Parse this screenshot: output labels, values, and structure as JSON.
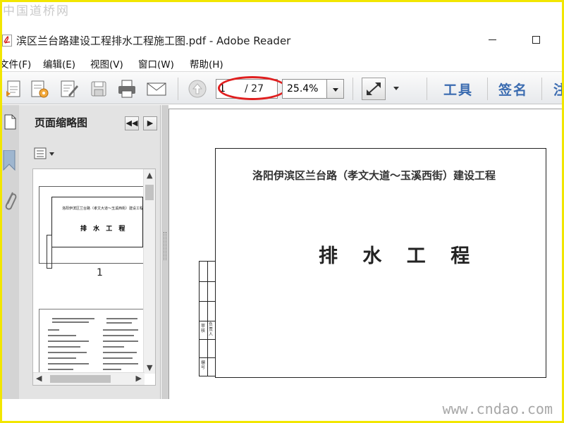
{
  "watermark": {
    "top": "中国道桥网",
    "bottom": "www.cndao.com"
  },
  "window": {
    "title": "滨区兰台路建设工程排水工程施工图.pdf - Adobe Reader",
    "min_symbol": "",
    "max_symbol": ""
  },
  "menu": [
    "文件(F)",
    "编辑(E)",
    "视图(V)",
    "窗口(W)",
    "帮助(H)"
  ],
  "toolbar": {
    "page_current": "1",
    "page_total": "/ 27",
    "zoom": "25.4%",
    "tools_label": "工具",
    "sign_label": "签名",
    "comment_label": "注"
  },
  "nav_panel": {
    "title": "页面缩略图",
    "prev_symbol": "◀◀",
    "next_symbol": "▶",
    "thumbnail_1_label": "1",
    "thumbnail_1_subtitle": "洛阳伊滨区兰台路（孝文大道～玉溪西街）建设工程",
    "thumbnail_1_title": "排 水 工 程"
  },
  "document": {
    "subtitle": "洛阳伊滨区兰台路（孝文大道～玉溪西街）建设工程",
    "main_title": "排 水 工 程",
    "title_block_text": [
      "审核",
      "负责人",
      "编号"
    ]
  },
  "colors": {
    "frame": "#f2e600",
    "annotation": "#e01f1f",
    "tool_link": "#3a6bb0",
    "panel_bg": "#e3e3e3",
    "toolbar_bg": "#e7e9ec"
  },
  "icons": [
    "pdf-file-icon",
    "create-pdf-icon",
    "settings-pdf-icon",
    "edit-icon",
    "save-icon",
    "print-icon",
    "email-icon",
    "previous-page-icon",
    "fit-page-icon",
    "pages-icon",
    "bookmark-icon",
    "attachment-icon",
    "options-icon"
  ]
}
